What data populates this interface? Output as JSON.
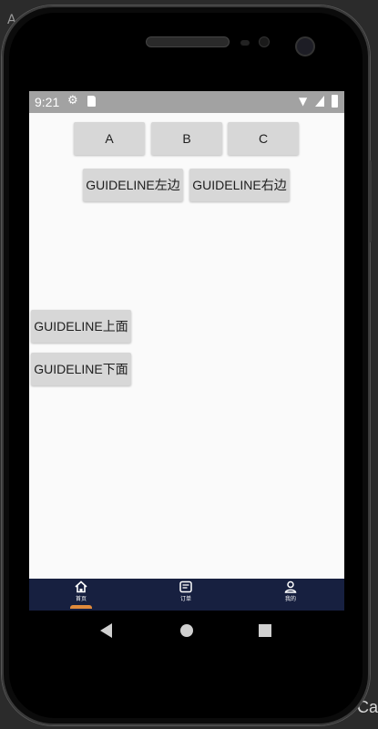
{
  "background": {
    "left_text": "A",
    "right_text": "Ca"
  },
  "status_bar": {
    "time": "9:21"
  },
  "buttons": {
    "a": "A",
    "b": "B",
    "c": "C",
    "guideline_left": "GUIDELINE左边",
    "guideline_right": "GUIDELINE右边",
    "guideline_top": "GUIDELINE上面",
    "guideline_bottom": "GUIDELINE下面"
  },
  "bottom_nav": {
    "items": [
      {
        "label": "首页",
        "icon": "home-icon",
        "active": true
      },
      {
        "label": "订单",
        "icon": "order-icon",
        "active": false
      },
      {
        "label": "我的",
        "icon": "profile-icon",
        "active": false
      }
    ]
  },
  "colors": {
    "status_bar": "#a2a2a2",
    "bottom_nav": "#172040",
    "button": "#d7d7d7",
    "screen_bg": "#fafafa",
    "active_underline": "#e08a3c"
  }
}
